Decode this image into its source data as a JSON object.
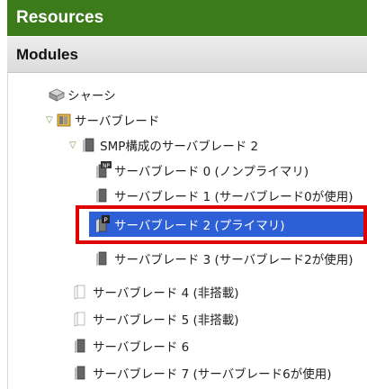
{
  "header": {
    "title": "Resources",
    "section": "Modules"
  },
  "tree": {
    "chassis": "シャーシ",
    "serverblade": "サーバブレード",
    "smp": "SMP構成のサーバブレード 2",
    "sb0": "サーバブレード 0 (ノンプライマリ)",
    "sb1": "サーバブレード 1 (サーバブレード0が使用)",
    "sb2": "サーバブレード 2 (プライマリ)",
    "sb3": "サーバブレード 3 (サーバブレード2が使用)",
    "sb4": "サーバブレード 4 (非搭載)",
    "sb5": "サーバブレード 5 (非搭載)",
    "sb6": "サーバブレード 6",
    "sb7": "サーバブレード 7 (サーバブレード6が使用)"
  },
  "icons": {
    "np_badge": "NP",
    "p_badge": "P"
  },
  "colors": {
    "resources_header": "#3b7b1a",
    "selection": "#2d5fd6",
    "highlight_box": "#e00000"
  }
}
